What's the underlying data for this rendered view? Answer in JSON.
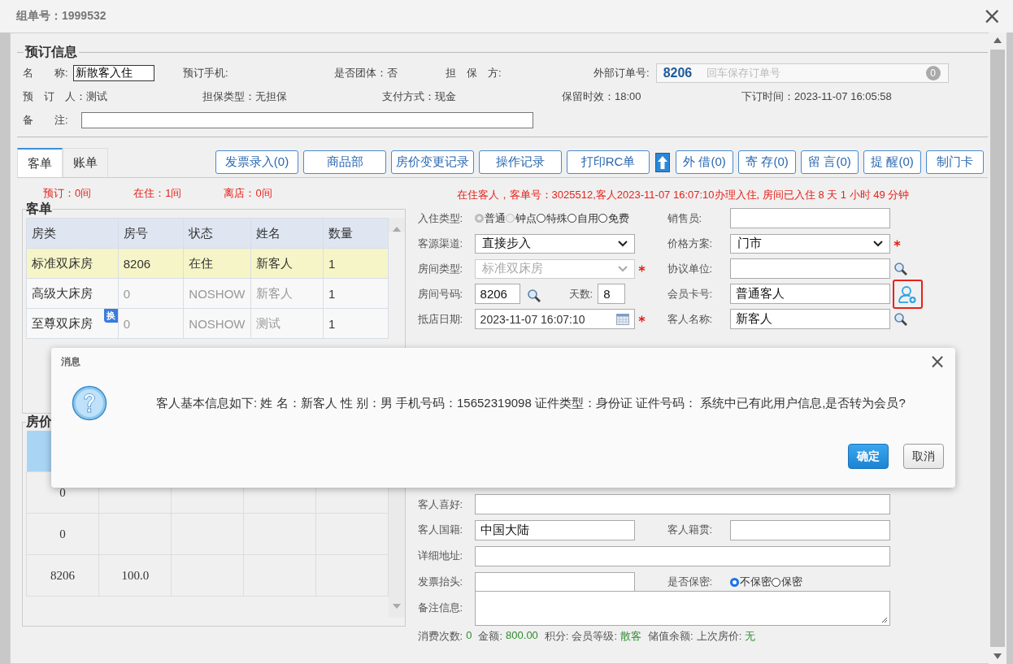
{
  "window": {
    "title": "组单号：1999532",
    "close": "×"
  },
  "booking": {
    "legend": "预订信息",
    "name": {
      "label": "名　　称:",
      "value": "新散客入住"
    },
    "phone_label": "预订手机:",
    "group": "是否团体：否",
    "guarantor_label": "担　保　方:",
    "external_order": {
      "label": "外部订单号:",
      "value": "8206",
      "placeholder": "回车保存订单号",
      "count": "0"
    },
    "info": [
      "预　订　人：测试",
      "担保类型：无担保",
      "支付方式：现金",
      "保留时效：18:00",
      "下订时间：2023-11-07 16:05:58"
    ],
    "remark_label": "备　　注:"
  },
  "tabs": [
    {
      "label": "客单",
      "selected": true
    },
    {
      "label": "账单",
      "selected": false
    }
  ],
  "toolbar": [
    {
      "kind": "text",
      "label": "发票录入(0)"
    },
    {
      "kind": "text",
      "label": "商品部"
    },
    {
      "kind": "text",
      "label": "房价变更记录"
    },
    {
      "kind": "text",
      "label": "操作记录"
    },
    {
      "kind": "text",
      "label": "打印RC单"
    },
    {
      "kind": "icon"
    },
    {
      "kind": "text",
      "label": "外 借(0)"
    },
    {
      "kind": "text",
      "label": "寄 存(0)"
    },
    {
      "kind": "text",
      "label": "留 言(0)"
    },
    {
      "kind": "text",
      "label": "提 醒(0)"
    },
    {
      "kind": "text",
      "label": "制门卡"
    }
  ],
  "counts": [
    "预订：0间",
    "在住：1间",
    "离店：0间"
  ],
  "status_message": "在住客人，客单号：3025512,客人2023-11-07 16:07:10办理入住, 房间已入住 8 天 1 小时 49 分钟",
  "guest_table": {
    "legend": "客单",
    "columns": [
      "房类",
      "房号",
      "状态",
      "姓名",
      "数量"
    ],
    "rows": [
      {
        "cells": [
          "标准双床房",
          "8206",
          "在住",
          "新客人",
          "1"
        ],
        "selected": true,
        "dimmed": false
      },
      {
        "cells": [
          "高级大床房",
          "0",
          "NOSHOW",
          "新客人",
          "1"
        ],
        "selected": false,
        "dimmed": true
      },
      {
        "cells": [
          "至尊双床房",
          "0",
          "NOSHOW",
          "测试",
          "1"
        ],
        "selected": false,
        "dimmed": true,
        "badge": "换"
      }
    ]
  },
  "price_table": {
    "legend": "房价",
    "rows": [
      [
        "0",
        ""
      ],
      [
        "0",
        ""
      ],
      [
        "8206",
        "100.0"
      ]
    ]
  },
  "form": [
    {
      "left": {
        "kind": "radios",
        "label": "入住类型:",
        "options": [
          {
            "label": "普通",
            "selected": true,
            "disabled": true
          },
          {
            "label": "钟点",
            "selected": false,
            "disabled": true
          },
          {
            "label": "特殊",
            "selected": false,
            "disabled": false
          },
          {
            "label": "自用",
            "selected": false,
            "disabled": false
          },
          {
            "label": "免费",
            "selected": false,
            "disabled": false
          }
        ]
      },
      "right": {
        "kind": "input",
        "label": "销售员:"
      }
    },
    {
      "left": {
        "kind": "select",
        "label": "客源渠道:",
        "value": "直接步入"
      },
      "right": {
        "kind": "select",
        "label": "价格方案:",
        "value": "门市",
        "required": true
      }
    },
    {
      "left": {
        "kind": "select",
        "label": "房间类型:",
        "value": "标准双床房",
        "disabled": true,
        "required": true
      },
      "right": {
        "kind": "input",
        "label": "协议单位:",
        "search_button": true
      }
    },
    {
      "left": {
        "kind": "room",
        "label": "房间号码:",
        "value": "8206",
        "days_label": "天数:",
        "days": "8"
      },
      "right": {
        "kind": "input",
        "label": "会员卡号:",
        "value": "普通客人",
        "member_button": true,
        "highlighted": true
      }
    },
    {
      "left": {
        "kind": "date",
        "label": "抵店日期:",
        "value": "2023-11-07 16:07:10",
        "required": true
      },
      "right": {
        "kind": "input",
        "label": "客人名称:",
        "value": "新客人",
        "search_button": true
      }
    }
  ],
  "form_lower": [
    {
      "full": {
        "kind": "input",
        "label": "客人喜好:"
      }
    },
    {
      "left": {
        "kind": "input",
        "label": "客人国籍:",
        "value": "中国大陆"
      },
      "right": {
        "kind": "input",
        "label": "客人籍贯:"
      }
    },
    {
      "full": {
        "kind": "input",
        "label": "详细地址:"
      }
    },
    {
      "left": {
        "kind": "input",
        "label": "发票抬头:"
      },
      "right": {
        "kind": "radios",
        "label": "是否保密:",
        "options": [
          {
            "label": "不保密",
            "selected": true,
            "disabled": false
          },
          {
            "label": "保密",
            "selected": false,
            "disabled": false
          }
        ]
      }
    },
    {
      "full": {
        "kind": "textarea",
        "label": "备注信息:"
      }
    }
  ],
  "summary": [
    {
      "label": "消费次数:",
      "value": "0"
    },
    {
      "label": "金额:",
      "value": "800.00"
    },
    {
      "label": "积分:"
    },
    {
      "label": "会员等级:",
      "value": "散客"
    },
    {
      "label": "储值余额:"
    },
    {
      "label": "上次房价:",
      "value": "无"
    }
  ],
  "dialog": {
    "title": "消息",
    "close": "×",
    "message": "客人基本信息如下:  姓 名：新客人 性 别：男 手机号码：15652319098 证件类型：身份证 证件号码：  系统中已有此用户信息,是否转为会员?",
    "buttons": [
      {
        "label": "确定",
        "primary": true
      },
      {
        "label": "取消",
        "primary": false
      }
    ]
  }
}
